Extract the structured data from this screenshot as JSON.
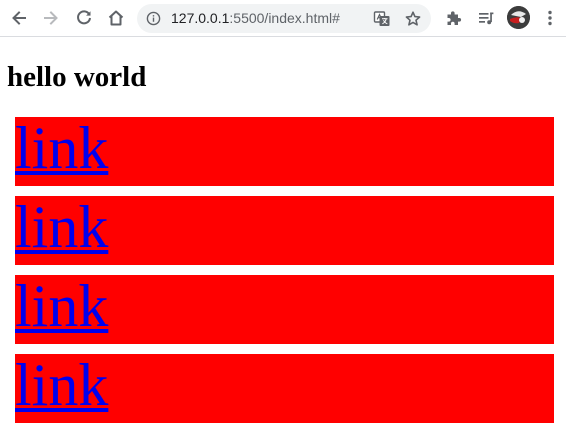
{
  "browser": {
    "url_host": "127.0.0.1",
    "url_rest": ":5500/index.html#"
  },
  "page": {
    "heading": "hello world",
    "links": [
      {
        "label": "link"
      },
      {
        "label": "link"
      },
      {
        "label": "link"
      },
      {
        "label": "link"
      }
    ]
  },
  "colors": {
    "box_background": "#ff0000",
    "link": "#0000ee"
  }
}
